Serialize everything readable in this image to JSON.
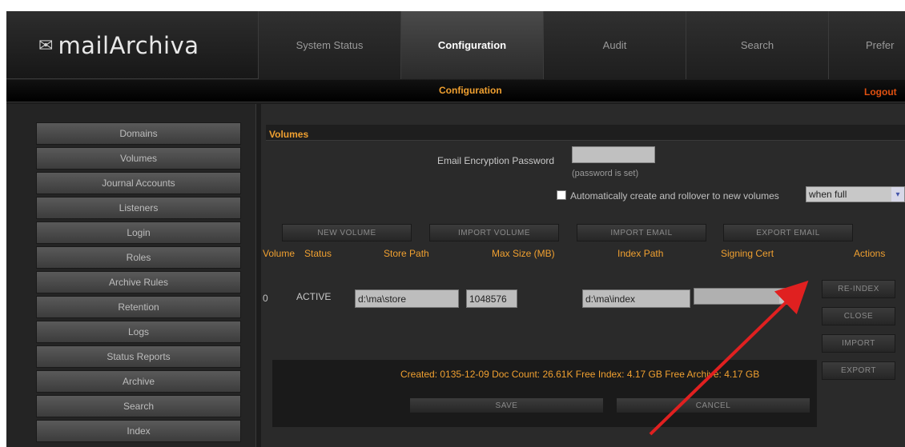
{
  "app": {
    "logo_text": "mailArchiva",
    "logo_icon": "envelope-icon"
  },
  "tabs": [
    {
      "label": "System Status",
      "active": false
    },
    {
      "label": "Configuration",
      "active": true
    },
    {
      "label": "Audit",
      "active": false
    },
    {
      "label": "Search",
      "active": false
    },
    {
      "label": "Prefer",
      "active": false
    }
  ],
  "subbar": {
    "title": "Configuration",
    "logout": "Logout"
  },
  "sidebar": {
    "items": [
      {
        "label": "Domains"
      },
      {
        "label": "Volumes"
      },
      {
        "label": "Journal Accounts"
      },
      {
        "label": "Listeners"
      },
      {
        "label": "Login"
      },
      {
        "label": "Roles"
      },
      {
        "label": "Archive Rules"
      },
      {
        "label": "Retention"
      },
      {
        "label": "Logs"
      },
      {
        "label": "Status Reports"
      },
      {
        "label": "Archive"
      },
      {
        "label": "Search"
      },
      {
        "label": "Index"
      }
    ]
  },
  "volumes": {
    "title": "Volumes",
    "encryption_label": "Email Encryption Password",
    "encryption_value": "",
    "encryption_note": "(password is set)",
    "auto_label": "Automatically create and rollover to new volumes",
    "auto_checked": true,
    "auto_select": "when full",
    "buttons": {
      "new_volume": "NEW VOLUME",
      "import_volume": "IMPORT VOLUME",
      "import_email": "IMPORT EMAIL",
      "export_email": "EXPORT EMAIL"
    },
    "columns": {
      "volume": "Volume",
      "status": "Status",
      "store_path": "Store Path",
      "max_size": "Max Size (MB)",
      "index_path": "Index Path",
      "signing_cert": "Signing Cert",
      "actions": "Actions"
    },
    "row": {
      "volume": "0",
      "status": "ACTIVE",
      "store_path": "d:\\ma\\store",
      "max_size": "1048576",
      "index_path": "d:\\ma\\index",
      "signing_cert": ""
    },
    "actions": {
      "reindex": "RE-INDEX",
      "close": "CLOSE",
      "import": "IMPORT",
      "export": "EXPORT"
    },
    "footer": "Created: 0135-12-09  Doc Count: 26.61K  Free Index: 4.17 GB  Free Archive: 4.17 GB",
    "save": "SAVE",
    "cancel": "CANCEL"
  },
  "colors": {
    "accent": "#f0a030",
    "logout": "#e05010",
    "arrow": "#e02020"
  }
}
